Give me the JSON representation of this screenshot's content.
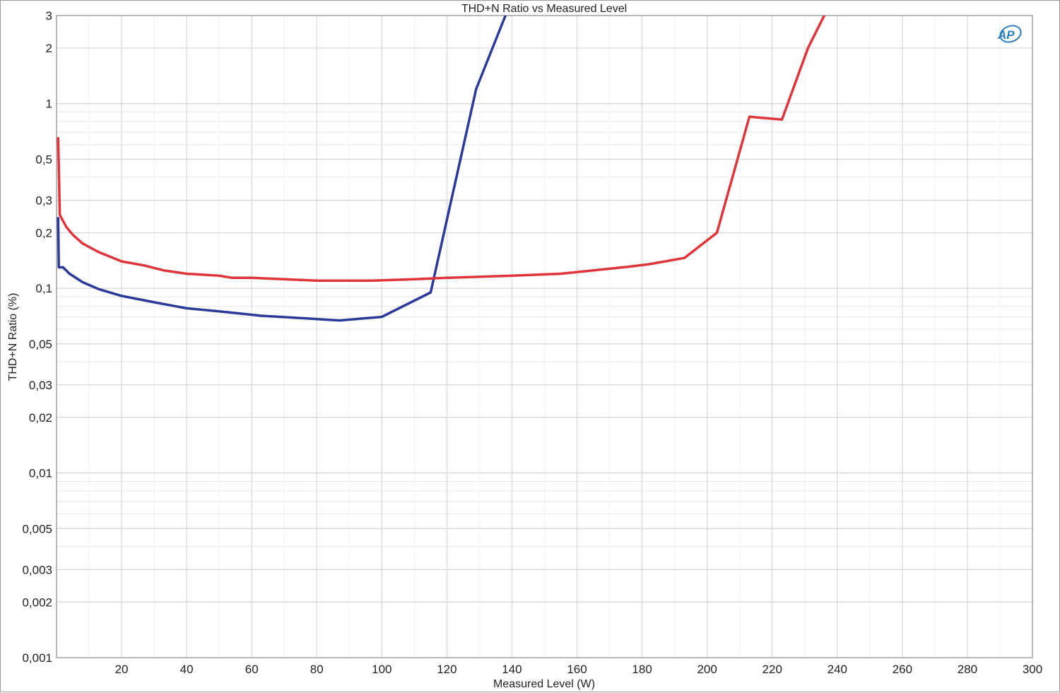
{
  "logo": {
    "text": "AP",
    "color": "#2a7fc1"
  },
  "chart_data": {
    "type": "line",
    "title": "THD+N Ratio vs Measured Level",
    "xlabel": "Measured Level (W)",
    "ylabel": "THD+N Ratio (%)",
    "xscale": "linear",
    "yscale": "log",
    "xlim": [
      0,
      300
    ],
    "ylim": [
      0.001,
      3
    ],
    "grid": true,
    "x_ticks": [
      20,
      40,
      60,
      80,
      100,
      120,
      140,
      160,
      180,
      200,
      220,
      240,
      260,
      280,
      300
    ],
    "x_tick_labels": [
      "20",
      "40",
      "60",
      "80",
      "100",
      "120",
      "140",
      "160",
      "180",
      "200",
      "220",
      "240",
      "260",
      "280",
      "300"
    ],
    "y_ticks": [
      0.001,
      0.002,
      0.003,
      0.005,
      0.01,
      0.02,
      0.03,
      0.05,
      0.1,
      0.2,
      0.3,
      0.5,
      1,
      2,
      3
    ],
    "y_tick_labels": [
      "0,001",
      "0,002",
      "0,003",
      "0,005",
      "0,01",
      "0,02",
      "0,03",
      "0,05",
      "0,1",
      "0,2",
      "0,3",
      "0,5",
      "1",
      "2",
      "3"
    ],
    "series": [
      {
        "color": "#2b3a9a",
        "points": [
          [
            0.5,
            0.24
          ],
          [
            0.7,
            0.13
          ],
          [
            2,
            0.13
          ],
          [
            4,
            0.12
          ],
          [
            8,
            0.108
          ],
          [
            13,
            0.099
          ],
          [
            20,
            0.091
          ],
          [
            30,
            0.084
          ],
          [
            40,
            0.078
          ],
          [
            50,
            0.075
          ],
          [
            63,
            0.071
          ],
          [
            75,
            0.069
          ],
          [
            87,
            0.067
          ],
          [
            100,
            0.07
          ],
          [
            115,
            0.095
          ],
          [
            129,
            1.2
          ],
          [
            138,
            3
          ]
        ]
      },
      {
        "color": "#e0343a",
        "points": [
          [
            0.5,
            0.65
          ],
          [
            1,
            0.25
          ],
          [
            3,
            0.215
          ],
          [
            5,
            0.195
          ],
          [
            8,
            0.175
          ],
          [
            13,
            0.157
          ],
          [
            20,
            0.14
          ],
          [
            27,
            0.133
          ],
          [
            33,
            0.125
          ],
          [
            40,
            0.12
          ],
          [
            50,
            0.117
          ],
          [
            54,
            0.114
          ],
          [
            60,
            0.114
          ],
          [
            70,
            0.112
          ],
          [
            80,
            0.11
          ],
          [
            97,
            0.11
          ],
          [
            110,
            0.112
          ],
          [
            120,
            0.114
          ],
          [
            140,
            0.117
          ],
          [
            155,
            0.12
          ],
          [
            165,
            0.125
          ],
          [
            176,
            0.131
          ],
          [
            182,
            0.135
          ],
          [
            193,
            0.146
          ],
          [
            203,
            0.2
          ],
          [
            213,
            0.85
          ],
          [
            223,
            0.82
          ],
          [
            231,
            2
          ],
          [
            236,
            3
          ]
        ]
      }
    ]
  }
}
